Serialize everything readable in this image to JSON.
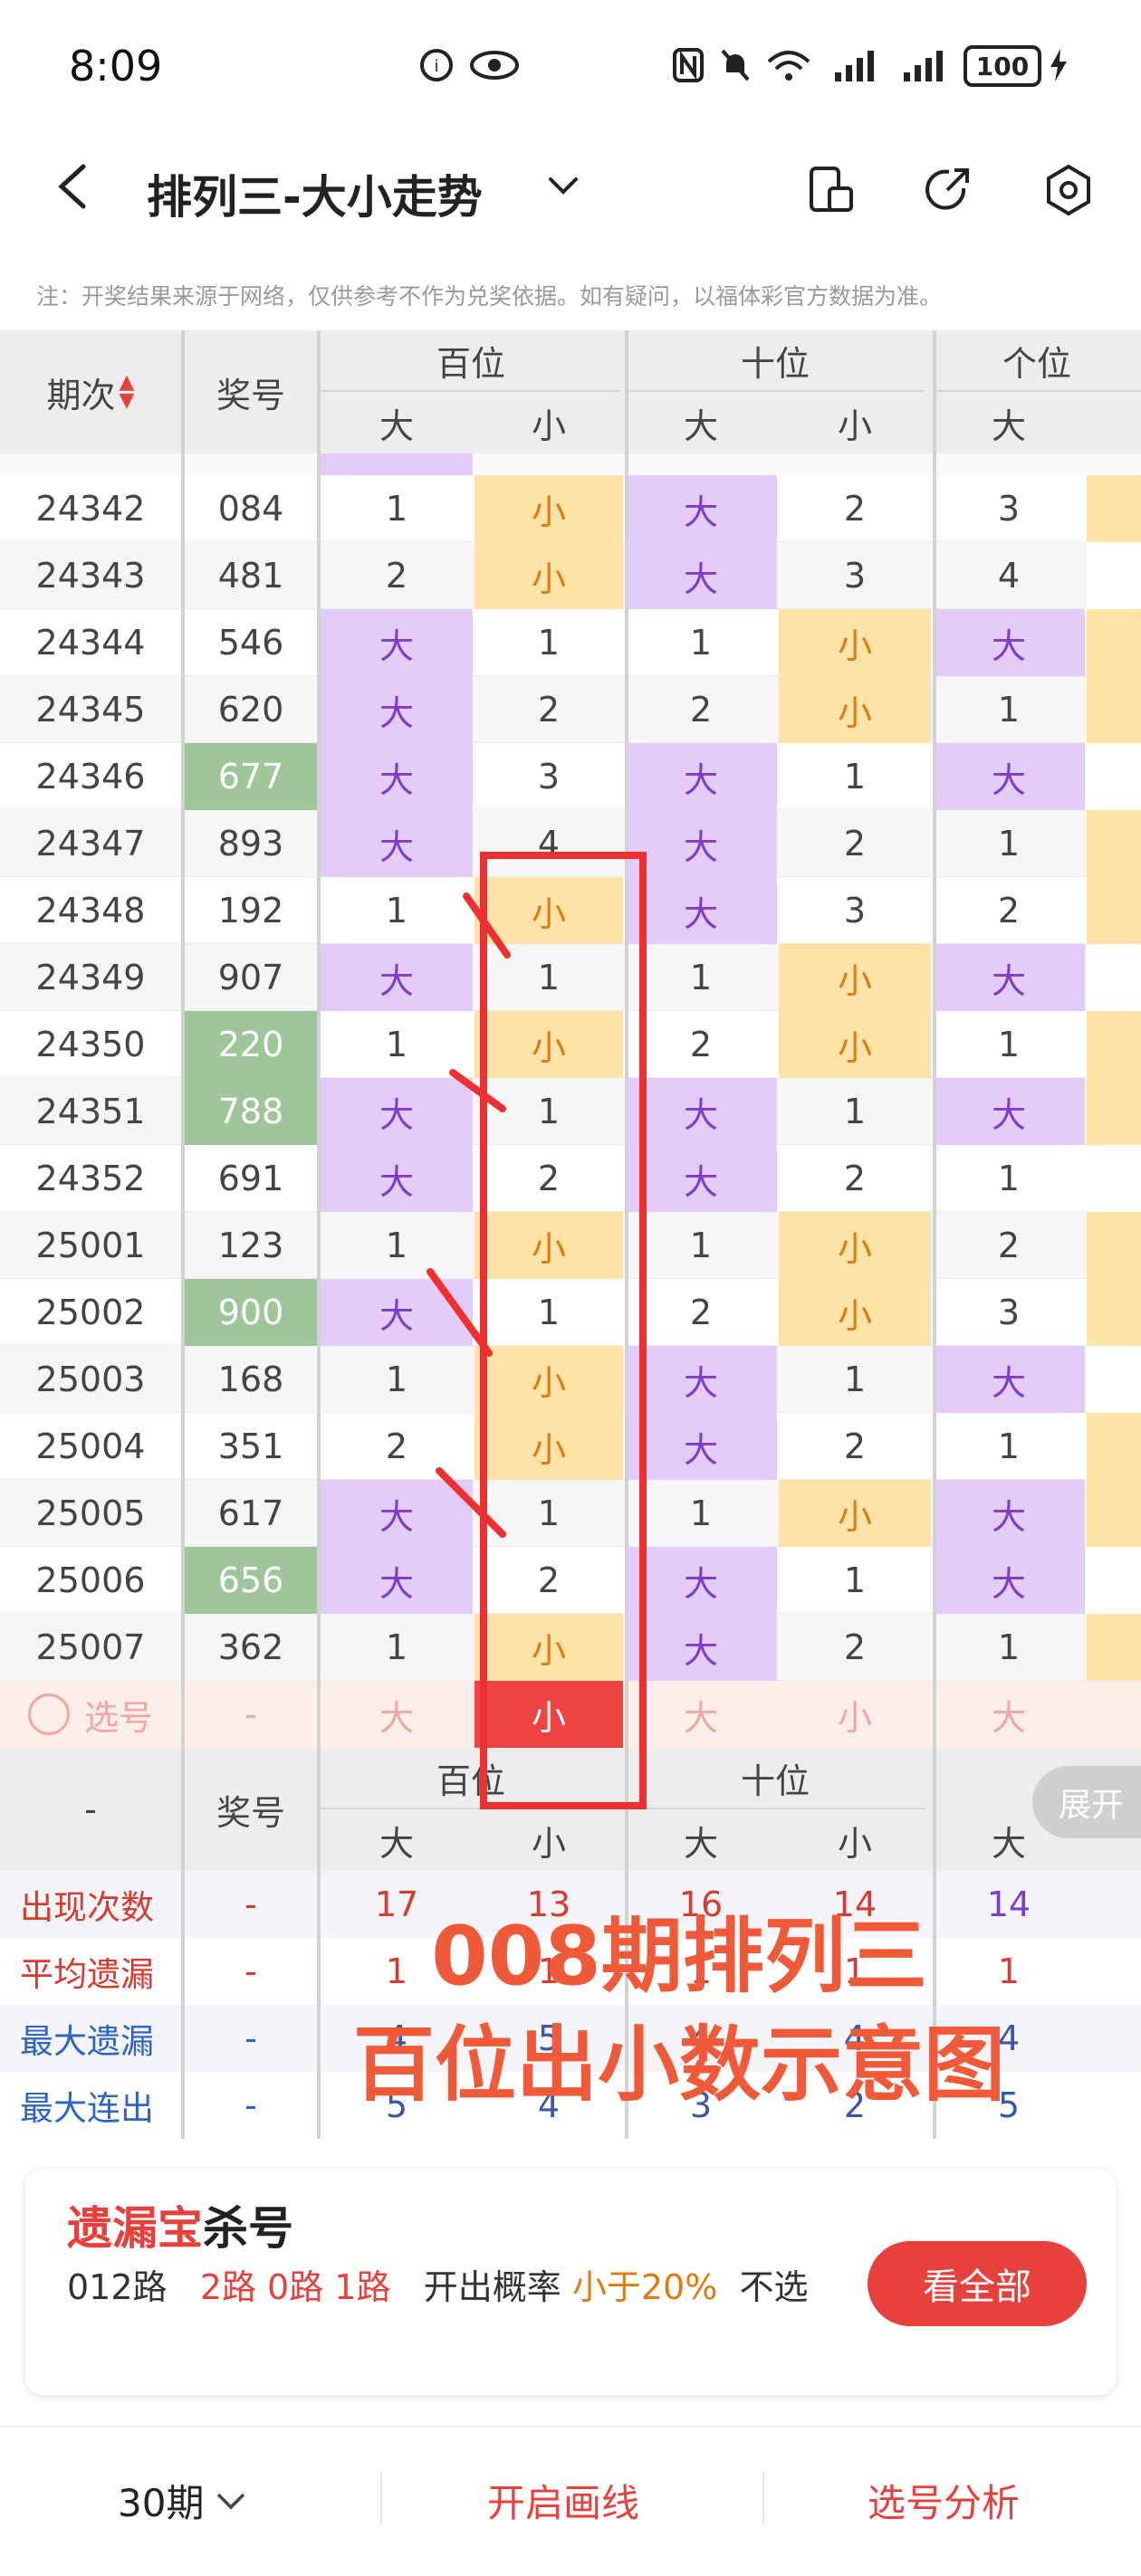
{
  "status_bar": {
    "time": "8:09",
    "battery": "100",
    "signal_tag": "6"
  },
  "header": {
    "title": "排列三-大小走势"
  },
  "notice": "注：开奖结果来源于网络，仅供参考不作为兑奖依据。如有疑问，以福体彩官方数据为准。",
  "table": {
    "col_period": "期次",
    "col_number": "奖号",
    "groups": [
      "百位",
      "十位",
      "个位"
    ],
    "sub_big": "大",
    "sub_small": "小",
    "rows": [
      {
        "p": "24342",
        "n": "084",
        "hot": false,
        "h": [
          "1",
          "小"
        ],
        "t": [
          "大",
          "2"
        ],
        "g": "3"
      },
      {
        "p": "24343",
        "n": "481",
        "hot": false,
        "h": [
          "2",
          "小"
        ],
        "t": [
          "大",
          "3"
        ],
        "g": "4"
      },
      {
        "p": "24344",
        "n": "546",
        "hot": false,
        "h": [
          "大",
          "1"
        ],
        "t": [
          "1",
          "小"
        ],
        "g": "大"
      },
      {
        "p": "24345",
        "n": "620",
        "hot": false,
        "h": [
          "大",
          "2"
        ],
        "t": [
          "2",
          "小"
        ],
        "g": "1"
      },
      {
        "p": "24346",
        "n": "677",
        "hot": true,
        "h": [
          "大",
          "3"
        ],
        "t": [
          "大",
          "1"
        ],
        "g": "大"
      },
      {
        "p": "24347",
        "n": "893",
        "hot": false,
        "h": [
          "大",
          "4"
        ],
        "t": [
          "大",
          "2"
        ],
        "g": "1"
      },
      {
        "p": "24348",
        "n": "192",
        "hot": false,
        "h": [
          "1",
          "小"
        ],
        "t": [
          "大",
          "3"
        ],
        "g": "2"
      },
      {
        "p": "24349",
        "n": "907",
        "hot": false,
        "h": [
          "大",
          "1"
        ],
        "t": [
          "1",
          "小"
        ],
        "g": "大"
      },
      {
        "p": "24350",
        "n": "220",
        "hot": true,
        "h": [
          "1",
          "小"
        ],
        "t": [
          "2",
          "小"
        ],
        "g": "1"
      },
      {
        "p": "24351",
        "n": "788",
        "hot": true,
        "h": [
          "大",
          "1"
        ],
        "t": [
          "大",
          "1"
        ],
        "g": "大"
      },
      {
        "p": "24352",
        "n": "691",
        "hot": false,
        "h": [
          "大",
          "2"
        ],
        "t": [
          "大",
          "2"
        ],
        "g": "1"
      },
      {
        "p": "25001",
        "n": "123",
        "hot": false,
        "h": [
          "1",
          "小"
        ],
        "t": [
          "1",
          "小"
        ],
        "g": "2"
      },
      {
        "p": "25002",
        "n": "900",
        "hot": true,
        "h": [
          "大",
          "1"
        ],
        "t": [
          "2",
          "小"
        ],
        "g": "3"
      },
      {
        "p": "25003",
        "n": "168",
        "hot": false,
        "h": [
          "1",
          "小"
        ],
        "t": [
          "大",
          "1"
        ],
        "g": "大"
      },
      {
        "p": "25004",
        "n": "351",
        "hot": false,
        "h": [
          "2",
          "小"
        ],
        "t": [
          "大",
          "2"
        ],
        "g": "1"
      },
      {
        "p": "25005",
        "n": "617",
        "hot": false,
        "h": [
          "大",
          "1"
        ],
        "t": [
          "1",
          "小"
        ],
        "g": "大"
      },
      {
        "p": "25006",
        "n": "656",
        "hot": true,
        "h": [
          "大",
          "2"
        ],
        "t": [
          "大",
          "1"
        ],
        "g": "大"
      },
      {
        "p": "25007",
        "n": "362",
        "hot": false,
        "h": [
          "1",
          "小"
        ],
        "t": [
          "大",
          "2"
        ],
        "g": "1"
      }
    ],
    "select_row": {
      "label": "选号",
      "dash": "-",
      "big": "大",
      "small": "小"
    },
    "stats_header": {
      "dash": "-",
      "number": "奖号",
      "expand": "展开"
    },
    "stats": [
      {
        "label": "出现次数",
        "color": "#d93a2e",
        "dash": "-",
        "vals": [
          "17",
          "13",
          "16",
          "14",
          "14"
        ]
      },
      {
        "label": "平均遗漏",
        "color": "#d93a2e",
        "dash": "-",
        "vals": [
          "1",
          "1",
          "1",
          "1",
          "1"
        ]
      },
      {
        "label": "最大遗漏",
        "color": "#2e63c8",
        "dash": "-",
        "vals": [
          "4",
          "5",
          "4",
          "4",
          "4"
        ]
      },
      {
        "label": "最大连出",
        "color": "#2e63c8",
        "dash": "-",
        "vals": [
          "5",
          "4",
          "3",
          "2",
          "5"
        ]
      }
    ]
  },
  "overlay": {
    "line1": "008期排列三",
    "line2": "百位出小数示意图"
  },
  "promo": {
    "brand": "遗漏宝",
    "title_rest": "杀号",
    "route": "012路",
    "routes_value": "2路 0路 1路",
    "prob_label": "开出概率",
    "prob_value": "小于20%",
    "tail": "不选",
    "button": "看全部"
  },
  "bottom_bar": {
    "periods": "30期",
    "draw_line": "开启画线",
    "analysis": "选号分析"
  },
  "colors": {
    "big_bg": "#e3ccf8",
    "small_bg": "#fde3a7",
    "hot_bg": "#9fc59b",
    "accent": "#e8403c"
  }
}
